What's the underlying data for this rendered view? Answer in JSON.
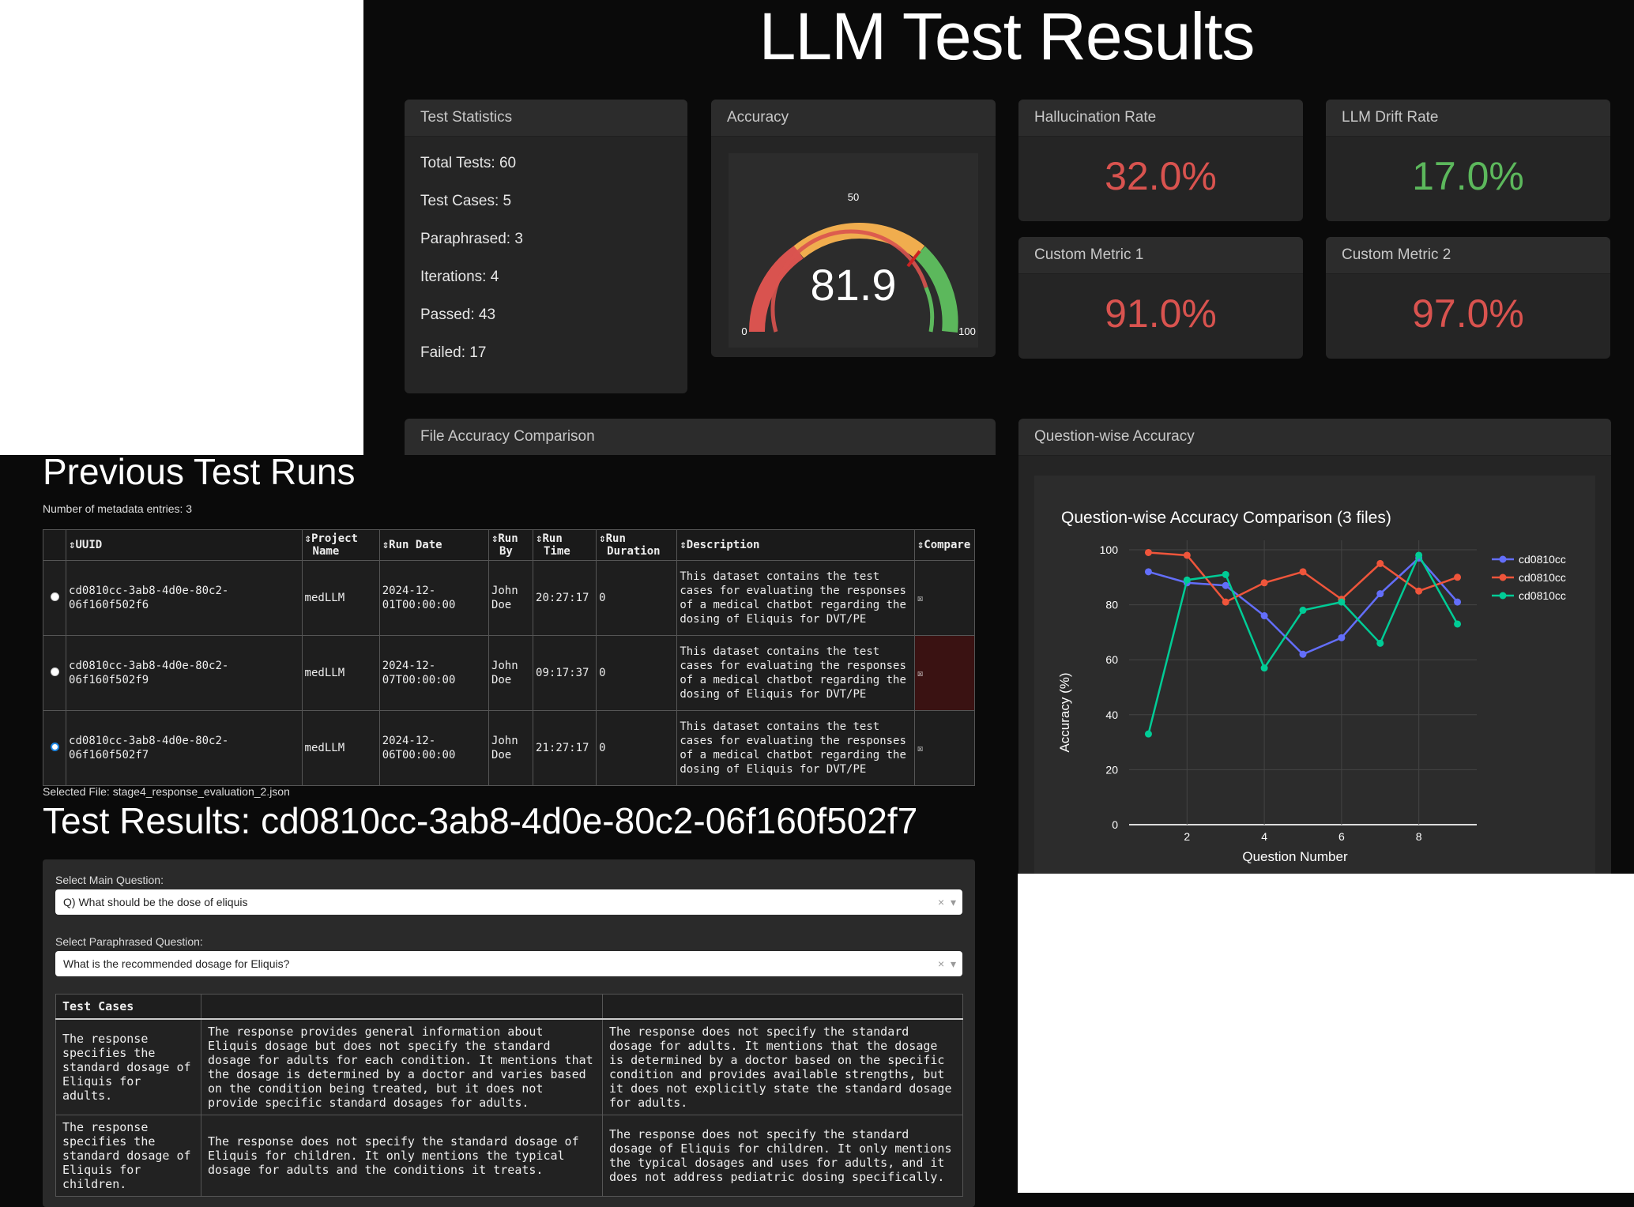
{
  "page_title": "LLM Test Results",
  "test_statistics": {
    "title": "Test Statistics",
    "lines": [
      "Total Tests: 60",
      "Test Cases: 5",
      "Paraphrased: 3",
      "Iterations: 4",
      "Passed: 43",
      "Failed: 17"
    ]
  },
  "accuracy": {
    "title": "Accuracy",
    "value": "81.9",
    "value_num": 81.9,
    "min": "0",
    "mid": "50",
    "max": "100"
  },
  "metrics": {
    "hallucination": {
      "title": "Hallucination Rate",
      "value": "32.0%",
      "color": "#d9534f"
    },
    "drift": {
      "title": "LLM Drift Rate",
      "value": "17.0%",
      "color": "#5cb85c"
    },
    "custom1": {
      "title": "Custom Metric 1",
      "value": "91.0%",
      "color": "#d9534f"
    },
    "custom2": {
      "title": "Custom Metric 2",
      "value": "97.0%",
      "color": "#d9534f"
    }
  },
  "file_accuracy": {
    "title": "File Accuracy Comparison"
  },
  "question_accuracy": {
    "title": "Question-wise Accuracy"
  },
  "previous_runs": {
    "title": "Previous Test Runs",
    "count_text": "Number of metadata entries: 3",
    "headers": {
      "uuid": "UUID",
      "project_1": "Project",
      "project_2": "Name",
      "run_date": "Run Date",
      "run_by_1": "Run",
      "run_by_2": "By",
      "run_time_1": "Run",
      "run_time_2": "Time",
      "run_dur_1": "Run",
      "run_dur_2": "Duration",
      "description": "Description",
      "compare": "Compare"
    },
    "rows": [
      {
        "uuid_1": "cd0810cc-3ab8-4d0e-80c2-",
        "uuid_2": "06f160f502f6",
        "project": "medLLM",
        "date_1": "2024-12-",
        "date_2": "01T00:00:00",
        "by_1": "John",
        "by_2": "Doe",
        "time": "20:27:17",
        "duration": "0",
        "description": "This dataset contains the test cases for evaluating the responses of a medical chatbot regarding the dosing of Eliquis for DVT/PE",
        "compare": "☒"
      },
      {
        "uuid_1": "cd0810cc-3ab8-4d0e-80c2-",
        "uuid_2": "06f160f502f9",
        "project": "medLLM",
        "date_1": "2024-12-",
        "date_2": "07T00:00:00",
        "by_1": "John",
        "by_2": "Doe",
        "time": "09:17:37",
        "duration": "0",
        "description": "This dataset contains the test cases for evaluating the responses of a medical chatbot regarding the dosing of Eliquis for DVT/PE",
        "compare": "☒"
      },
      {
        "uuid_1": "cd0810cc-3ab8-4d0e-80c2-",
        "uuid_2": "06f160f502f7",
        "project": "medLLM",
        "date_1": "2024-12-",
        "date_2": "06T00:00:00",
        "by_1": "John",
        "by_2": "Doe",
        "time": "21:27:17",
        "duration": "0",
        "description": "This dataset contains the test cases for evaluating the responses of a medical chatbot regarding the dosing of Eliquis for DVT/PE",
        "compare": "☒"
      }
    ]
  },
  "selected_file": "Selected File: stage4_response_evaluation_2.json",
  "results": {
    "title": "Test Results: cd0810cc-3ab8-4d0e-80c2-06f160f502f7",
    "main_question_label": "Select Main Question:",
    "main_question_value": "Q) What should be the dose of eliquis",
    "para_question_label": "Select Paraphrased Question:",
    "para_question_value": "What is the recommended dosage for Eliquis?",
    "clear": "×",
    "caret": "▾",
    "cases_header": "Test Cases",
    "cases": [
      {
        "case": "The response specifies the standard dosage of Eliquis for adults.",
        "col2": "The response provides general information about Eliquis dosage but does not specify the standard dosage for adults for each condition. It mentions that the dosage is determined by a doctor and varies based on the condition being treated, but it does not provide specific standard dosages for adults.",
        "col3": "The response does not specify the standard dosage for adults. It mentions that the dosage is determined by a doctor based on the specific condition and provides available strengths, but it does not explicitly state the standard dosage for adults."
      },
      {
        "case": "The response specifies the standard dosage of Eliquis for children.",
        "col2": "The response does not specify the standard dosage of Eliquis for children. It only mentions the typical dosage for adults and the conditions it treats.",
        "col3": "The response does not specify the standard dosage of Eliquis for children. It only mentions the typical dosages and uses for adults, and it does not address pediatric dosing specifically."
      }
    ]
  },
  "chart_data": {
    "type": "line",
    "title": "Question-wise Accuracy Comparison (3 files)",
    "xlabel": "Question Number",
    "ylabel": "Accuracy (%)",
    "ylim": [
      0,
      100
    ],
    "xlim": [
      0.5,
      9.5
    ],
    "yticks": [
      0,
      20,
      40,
      60,
      80,
      100
    ],
    "xticks": [
      2,
      4,
      6,
      8
    ],
    "grid": true,
    "legend_position": "right",
    "x": [
      1,
      2,
      3,
      4,
      5,
      6,
      7,
      8,
      9
    ],
    "series": [
      {
        "name": "cd0810cc",
        "color": "#636efa",
        "values": [
          92,
          88,
          87,
          76,
          62,
          68,
          84,
          97,
          81
        ]
      },
      {
        "name": "cd0810cc",
        "color": "#ef553b",
        "values": [
          99,
          98,
          81,
          88,
          92,
          82,
          95,
          85,
          90
        ]
      },
      {
        "name": "cd0810cc",
        "color": "#00cc96",
        "values": [
          33,
          89,
          91,
          57,
          78,
          81,
          66,
          98,
          73
        ]
      }
    ]
  }
}
